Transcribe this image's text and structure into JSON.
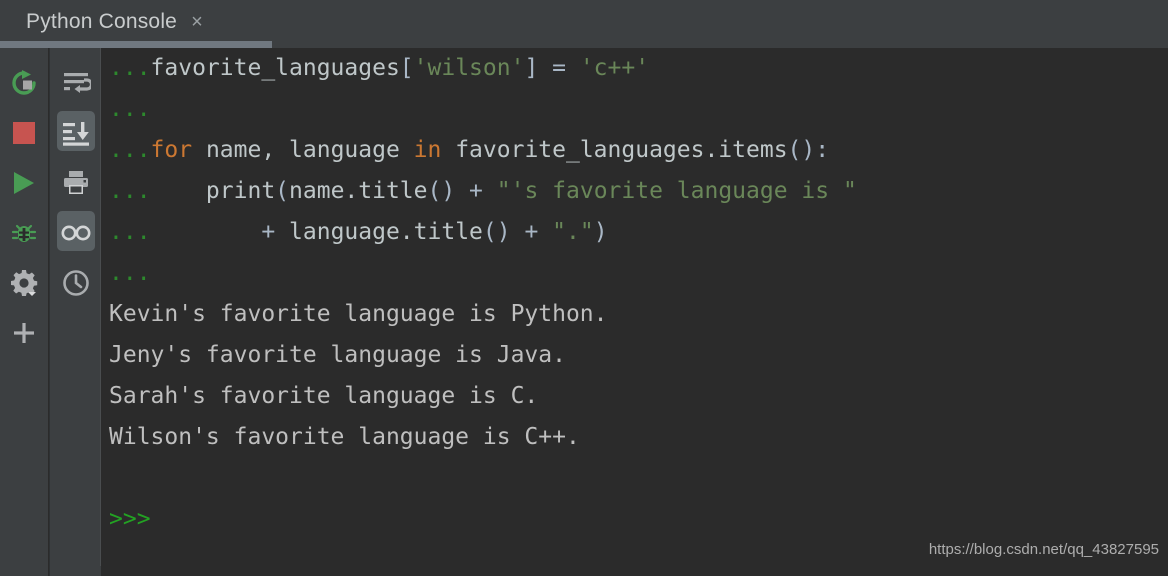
{
  "window": {
    "background_color": "#2b2b2b",
    "chrome_color": "#3c3f41"
  },
  "tab": {
    "label": "Python Console",
    "close_glyph": "×"
  },
  "toolbar_left": {
    "items": [
      {
        "name": "rerun-icon",
        "tooltip": "Rerun",
        "color": "#499c54",
        "selected": false
      },
      {
        "name": "stop-icon",
        "tooltip": "Stop",
        "color": "#c75450",
        "selected": false
      },
      {
        "name": "run-icon",
        "tooltip": "Execute",
        "color": "#499c54",
        "selected": false
      },
      {
        "name": "debug-bug-icon",
        "tooltip": "Debug",
        "color": "#499c54",
        "selected": false
      },
      {
        "name": "settings-gear-icon",
        "tooltip": "Settings",
        "color": "#afb1b3",
        "selected": false
      },
      {
        "name": "plus-icon",
        "tooltip": "New Console",
        "color": "#afb1b3",
        "selected": false
      }
    ]
  },
  "toolbar_right": {
    "items": [
      {
        "name": "soft-wrap-icon",
        "tooltip": "Use Soft Wraps",
        "color": "#a9acae",
        "selected": false
      },
      {
        "name": "scroll-to-end-icon",
        "tooltip": "Scroll to the End",
        "color": "#d4d6d7",
        "selected": true
      },
      {
        "name": "print-icon",
        "tooltip": "Print",
        "color": "#a9acae",
        "selected": false
      },
      {
        "name": "glasses-icon",
        "tooltip": "Show Console Variables",
        "color": "#d4d6d7",
        "selected": true
      },
      {
        "name": "history-clock-icon",
        "tooltip": "History",
        "color": "#a9acae",
        "selected": false
      }
    ]
  },
  "console": {
    "continuation_prompt": "...",
    "ps1_prompt": ">>>",
    "lines": [
      {
        "type": "input",
        "prompt": "...",
        "tokens": [
          {
            "t": "favorite_languages",
            "c": "id"
          },
          {
            "t": "[",
            "c": "punc"
          },
          {
            "t": "'wilson'",
            "c": "str"
          },
          {
            "t": "] = ",
            "c": "punc"
          },
          {
            "t": "'c++'",
            "c": "str"
          }
        ]
      },
      {
        "type": "input",
        "prompt": "...",
        "tokens": []
      },
      {
        "type": "input",
        "prompt": "...",
        "tokens": [
          {
            "t": "for",
            "c": "kw"
          },
          {
            "t": " name, language ",
            "c": "id"
          },
          {
            "t": "in",
            "c": "kw"
          },
          {
            "t": " favorite_languages.items",
            "c": "id"
          },
          {
            "t": "():",
            "c": "punc"
          }
        ]
      },
      {
        "type": "input",
        "prompt": "...",
        "tokens": [
          {
            "t": "    print",
            "c": "id"
          },
          {
            "t": "(",
            "c": "punc"
          },
          {
            "t": "name.title",
            "c": "id"
          },
          {
            "t": "() + ",
            "c": "punc"
          },
          {
            "t": "\"'s favorite language is \"",
            "c": "str"
          }
        ]
      },
      {
        "type": "input",
        "prompt": "...",
        "tokens": [
          {
            "t": "        + ",
            "c": "punc"
          },
          {
            "t": "language.title",
            "c": "id"
          },
          {
            "t": "() + ",
            "c": "punc"
          },
          {
            "t": "\".\"",
            "c": "str"
          },
          {
            "t": ")",
            "c": "punc"
          }
        ]
      },
      {
        "type": "input",
        "prompt": "...",
        "tokens": []
      },
      {
        "type": "output",
        "text": "Kevin's favorite language is Python."
      },
      {
        "type": "output",
        "text": "Jeny's favorite language is Java."
      },
      {
        "type": "output",
        "text": "Sarah's favorite language is C."
      },
      {
        "type": "output",
        "text": "Wilson's favorite language is C++."
      },
      {
        "type": "blank",
        "text": ""
      },
      {
        "type": "ps1",
        "text": ">>>"
      }
    ]
  },
  "watermark": {
    "text": "https://blog.csdn.net/qq_43827595"
  }
}
